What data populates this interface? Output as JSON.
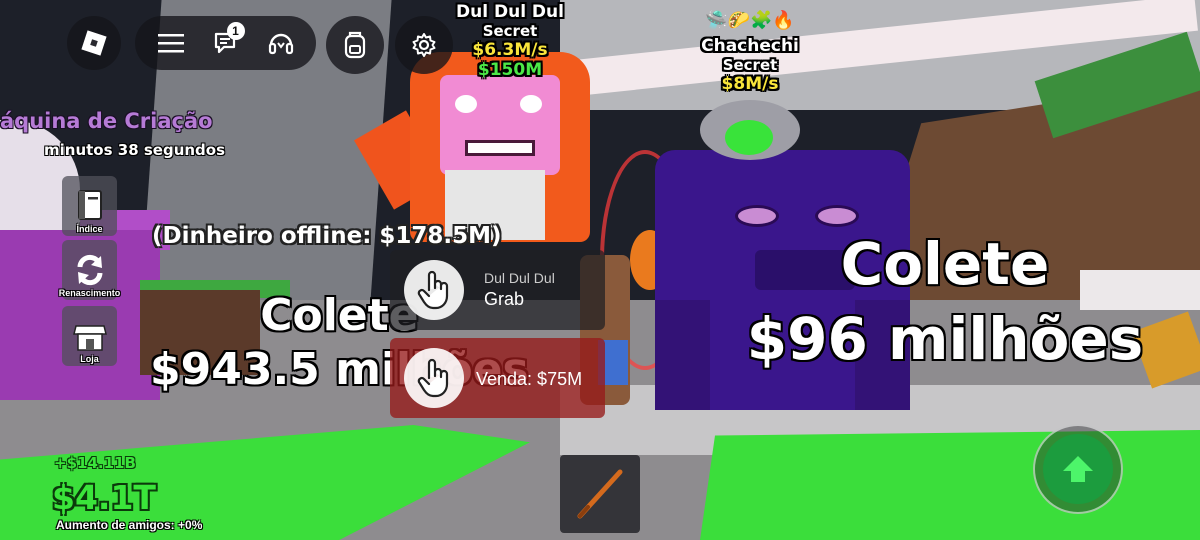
{
  "hud": {
    "chat_badge": "1"
  },
  "machine": {
    "title": "áquina de Criação",
    "timer": "minutos 38 segundos"
  },
  "side_menu": {
    "index_label": "Índice",
    "rebirth_label": "Renascimento",
    "shop_label": "Loja"
  },
  "offline_money": "(Dinheiro offline: $178.5M)",
  "brainrot_1": {
    "name": "Dul Dul Dul",
    "rarity": "Secret",
    "rate": "$6.3M/s",
    "price": "$150M"
  },
  "brainrot_2": {
    "name": "Chachechi",
    "rarity": "Secret",
    "rate": "$8M/s"
  },
  "collect_left": {
    "label": "Colete",
    "amount": "$943.5 milhões"
  },
  "collect_right": {
    "label": "Colete",
    "amount": "$96 milhões"
  },
  "prompts": {
    "grab_object": "Dul Dul Dul",
    "grab_action": "Grab",
    "sell_action": "Venda: $75M"
  },
  "stats": {
    "income": "+$14.11B",
    "cash": "$4.1T",
    "friends_boost": "Aumento de amigos: +0%"
  },
  "colors": {
    "cash_green": "#3ae53a",
    "rate_yellow": "#f9e53b",
    "machine_purple": "#b67bd6",
    "sell_red": "#961919"
  },
  "icons": [
    "roblox-logo-icon",
    "menu-icon",
    "chat-icon",
    "headset-icon",
    "backpack-icon",
    "gear-icon",
    "book-icon",
    "refresh-icon",
    "shop-icon",
    "hand-pointer-icon",
    "bat-icon",
    "jump-arrow-icon"
  ]
}
